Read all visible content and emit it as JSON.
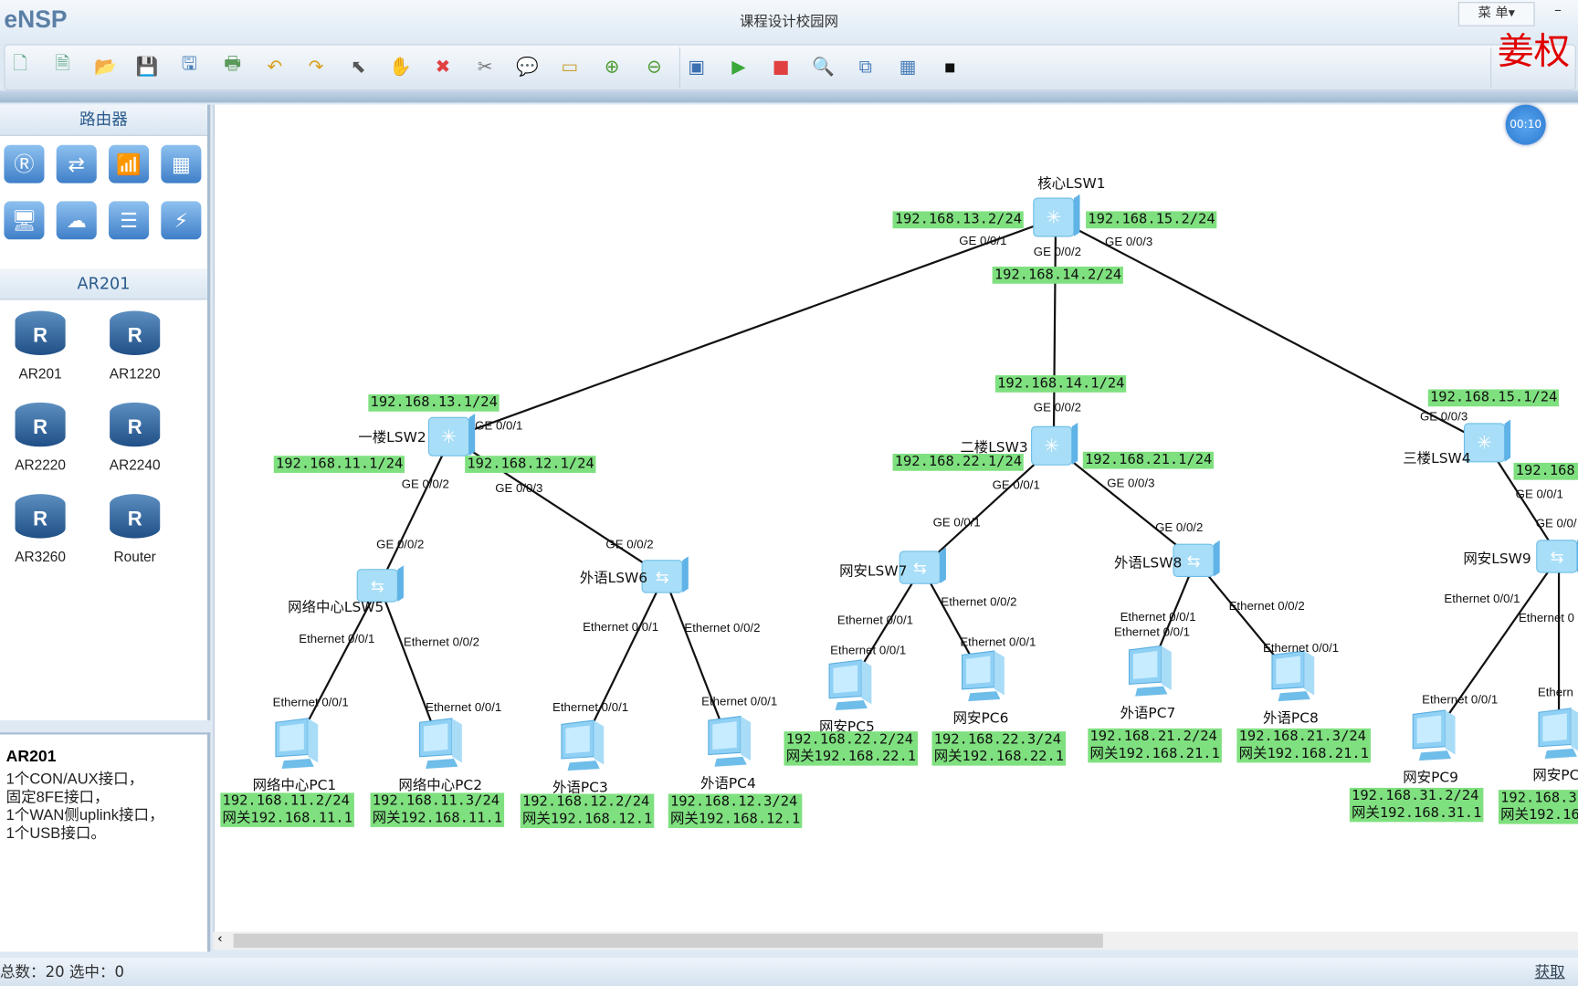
{
  "app": {
    "logo": "eNSP",
    "title": "课程设计校园网",
    "menu_label": "菜 单▾",
    "minimize": "–",
    "watermark": "姜权",
    "timer": "00:10"
  },
  "toolbar": {
    "icons": [
      "new-topology-icon",
      "new-test-icon",
      "open-icon",
      "save-icon",
      "save-as-icon",
      "print-icon",
      "undo-icon",
      "redo-icon",
      "select-icon",
      "hand-icon",
      "delete-icon",
      "delete-link-icon",
      "text-icon",
      "rectangle-icon",
      "zoom-in-icon",
      "zoom-out-icon",
      "fit-icon",
      "start-icon",
      "stop-icon",
      "capture-icon",
      "topology-icon",
      "table-icon",
      "terminal-icon"
    ]
  },
  "palette": {
    "category_title": "路由器",
    "subtitle": "AR201",
    "devices": [
      {
        "label": "AR201"
      },
      {
        "label": "AR1220"
      },
      {
        "label": "AR2220"
      },
      {
        "label": "AR2240"
      },
      {
        "label": "AR3260"
      },
      {
        "label": "Router"
      }
    ]
  },
  "info": {
    "title": "AR201",
    "text": "1个CON/AUX接口，\n固定8FE接口，\n1个WAN侧uplink接口，\n1个USB接口。"
  },
  "status": {
    "summary": "总数：20  选中：0",
    "help": "获取帮"
  },
  "canvas": {
    "devices": [
      {
        "name": "核心LSW1",
        "type": "l3-switch"
      },
      {
        "name": "一楼LSW2",
        "type": "l3-switch"
      },
      {
        "name": "二楼LSW3",
        "type": "l3-switch"
      },
      {
        "name": "三楼LSW4",
        "type": "l3-switch"
      },
      {
        "name": "网络中心LSW5",
        "type": "l2-switch"
      },
      {
        "name": "外语LSW6",
        "type": "l2-switch"
      },
      {
        "name": "网安LSW7",
        "type": "l2-switch"
      },
      {
        "name": "外语LSW8",
        "type": "l2-switch"
      },
      {
        "name": "网安LSW9",
        "type": "l2-switch"
      },
      {
        "name": "网络中心PC1",
        "type": "pc"
      },
      {
        "name": "网络中心PC2",
        "type": "pc"
      },
      {
        "name": "外语PC3",
        "type": "pc"
      },
      {
        "name": "外语PC4",
        "type": "pc"
      },
      {
        "name": "网安PC5",
        "type": "pc"
      },
      {
        "name": "网安PC6",
        "type": "pc"
      },
      {
        "name": "外语PC7",
        "type": "pc"
      },
      {
        "name": "外语PC8",
        "type": "pc"
      },
      {
        "name": "网安PC9",
        "type": "pc"
      },
      {
        "name": "网安PC",
        "type": "pc"
      }
    ],
    "links": [
      [
        "核心LSW1",
        "一楼LSW2"
      ],
      [
        "核心LSW1",
        "二楼LSW3"
      ],
      [
        "核心LSW1",
        "三楼LSW4"
      ],
      [
        "一楼LSW2",
        "网络中心LSW5"
      ],
      [
        "一楼LSW2",
        "外语LSW6"
      ],
      [
        "二楼LSW3",
        "网安LSW7"
      ],
      [
        "二楼LSW3",
        "外语LSW8"
      ],
      [
        "三楼LSW4",
        "网安LSW9"
      ],
      [
        "网络中心LSW5",
        "网络中心PC1"
      ],
      [
        "网络中心LSW5",
        "网络中心PC2"
      ],
      [
        "外语LSW6",
        "外语PC3"
      ],
      [
        "外语LSW6",
        "外语PC4"
      ],
      [
        "网安LSW7",
        "网安PC5"
      ],
      [
        "网安LSW7",
        "网安PC6"
      ],
      [
        "外语LSW8",
        "外语PC7"
      ],
      [
        "外语LSW8",
        "外语PC8"
      ],
      [
        "网安LSW9",
        "网安PC9"
      ],
      [
        "网安LSW9",
        "网安PC"
      ]
    ],
    "ip_labels": [
      "192.168.13.2/24",
      "192.168.15.2/24",
      "192.168.14.2/24",
      "192.168.14.1/24",
      "192.168.13.1/24",
      "192.168.11.1/24",
      "192.168.12.1/24",
      "192.168.22.1/24",
      "192.168.21.1/24",
      "192.168.15.1/24",
      "192.168.",
      "192.168.11.2/24\n网关192.168.11.1",
      "192.168.11.3/24\n网关192.168.11.1",
      "192.168.12.2/24\n网关192.168.12.1",
      "192.168.12.3/24\n网关192.168.12.1",
      "192.168.22.2/24\n网关192.168.22.1",
      "192.168.22.3/24\n网关192.168.22.1",
      "192.168.21.2/24\n网关192.168.21.1",
      "192.168.21.3/24\n网关192.168.21.1",
      "192.168.31.2/24\n网关192.168.31.1",
      "192.168.3\n网关192.16"
    ],
    "port_labels": [
      "GE 0/0/1",
      "GE 0/0/2",
      "GE 0/0/3",
      "GE 0/0/1",
      "GE 0/0/2",
      "GE 0/0/3",
      "GE 0/0/2",
      "GE 0/0/2",
      "GE 0/0/2",
      "GE 0/0/1",
      "GE 0/0/3",
      "GE 0/0/1",
      "GE 0/0/2",
      "GE 0/0/3",
      "GE 0/0/1",
      "GE 0/0/",
      "Ethernet 0/0/1",
      "Ethernet 0/0/2",
      "Ethernet 0/0/1",
      "Ethernet 0/0/1",
      "Ethernet 0/0/1",
      "Ethernet 0/0/2",
      "Ethernet 0/0/1",
      "Ethernet 0/0/1",
      "Ethernet 0/0/1",
      "Ethernet 0/0/2",
      "Ethernet 0/0/1",
      "Ethernet 0/0/1",
      "Ethernet 0/0/1",
      "Ethernet 0/0/1",
      "Ethernet 0/0/2",
      "Ethernet 0/0/1",
      "Ethernet 0/0/1",
      "Ethernet 0",
      "Ethernet 0/0/1",
      "Ethern"
    ]
  }
}
